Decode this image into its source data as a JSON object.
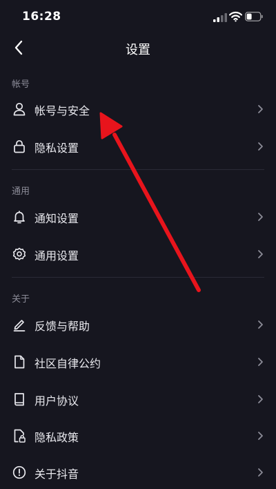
{
  "status_bar": {
    "time": "16:28"
  },
  "nav": {
    "title": "设置"
  },
  "sections": [
    {
      "header": "帐号",
      "items": [
        {
          "label": "帐号与安全",
          "icon": "user-icon"
        },
        {
          "label": "隐私设置",
          "icon": "lock-icon"
        }
      ]
    },
    {
      "header": "通用",
      "items": [
        {
          "label": "通知设置",
          "icon": "bell-icon"
        },
        {
          "label": "通用设置",
          "icon": "gear-icon"
        }
      ]
    },
    {
      "header": "关于",
      "items": [
        {
          "label": "反馈与帮助",
          "icon": "edit-icon"
        },
        {
          "label": "社区自律公约",
          "icon": "document-icon"
        },
        {
          "label": "用户协议",
          "icon": "book-icon"
        },
        {
          "label": "隐私政策",
          "icon": "document-lock-icon"
        },
        {
          "label": "关于抖音",
          "icon": "info-icon"
        }
      ]
    }
  ],
  "colors": {
    "background": "#16161f",
    "annotation": "#e8141c"
  }
}
